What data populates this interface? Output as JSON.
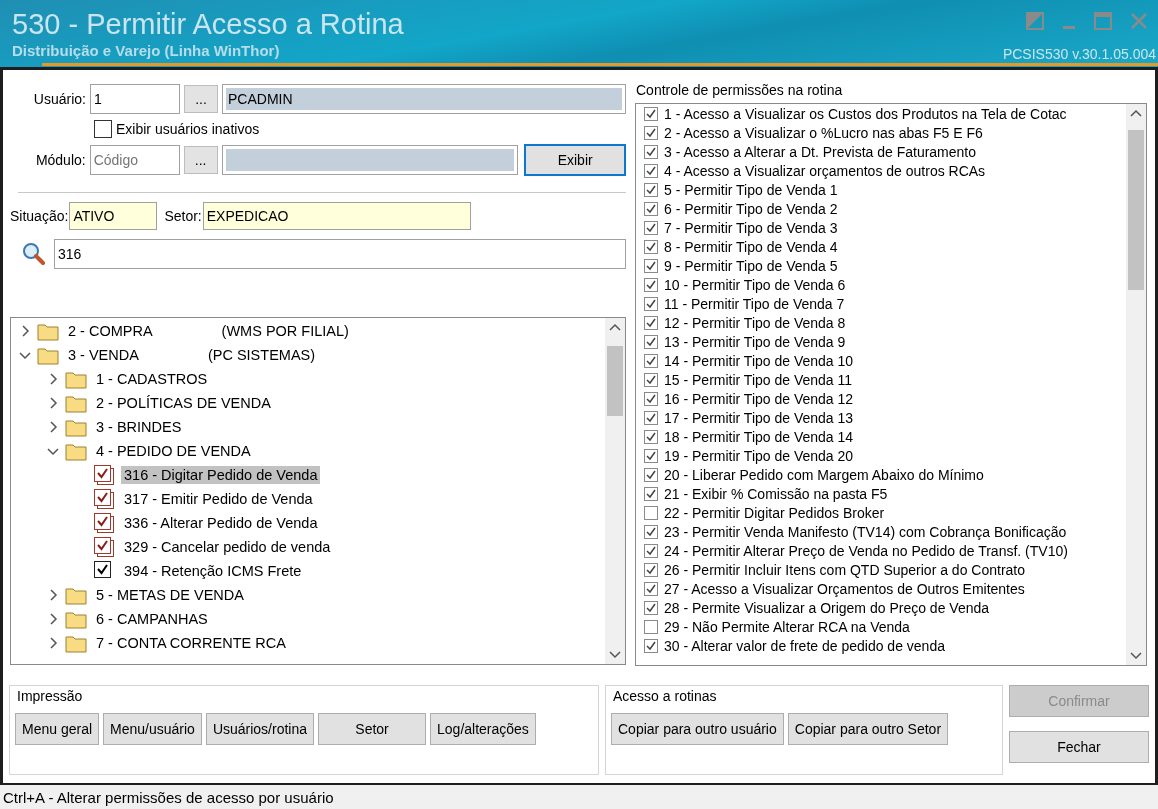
{
  "window": {
    "title": "530 - Permitir Acesso a Rotina",
    "subtitle": "Distribuição e Varejo (Linha WinThor)",
    "version": "PCSIS530  v.30.1.05.004"
  },
  "user": {
    "label": "Usuário:",
    "code": "1",
    "browse": "...",
    "name": "PCADMIN"
  },
  "show_inactive": {
    "label": "Exibir usuários inativos",
    "checked": false
  },
  "module": {
    "label": "Módulo:",
    "placeholder": "Código",
    "browse": "...",
    "button": "Exibir"
  },
  "situation": {
    "label": "Situação:",
    "value": "ATIVO"
  },
  "sector": {
    "label": "Setor:",
    "value": "EXPEDICAO"
  },
  "search": {
    "value": "316"
  },
  "tree": [
    {
      "kind": "folder",
      "label": "2 - COMPRA",
      "note": "(WMS POR FILIAL)",
      "expanded": false,
      "selected": false
    },
    {
      "kind": "folder",
      "label": "3 - VENDA",
      "note": "(PC SISTEMAS)",
      "expanded": true,
      "selected": false,
      "children": [
        {
          "kind": "folder",
          "label": "1 - CADASTROS",
          "expanded": false,
          "selected": false
        },
        {
          "kind": "folder",
          "label": "2 - POLÍTICAS DE VENDA",
          "expanded": false,
          "selected": false
        },
        {
          "kind": "folder",
          "label": "3 - BRINDES",
          "expanded": false,
          "selected": false
        },
        {
          "kind": "folder",
          "label": "4 - PEDIDO DE VENDA",
          "expanded": true,
          "selected": false,
          "children": [
            {
              "kind": "routine",
              "label": "316 - Digitar Pedido de Venda",
              "checked": true,
              "partial": true,
              "selected": true
            },
            {
              "kind": "routine",
              "label": "317 - Emitir Pedido de Venda",
              "checked": true,
              "partial": true,
              "selected": false
            },
            {
              "kind": "routine",
              "label": "336 - Alterar Pedido de Venda",
              "checked": true,
              "partial": true,
              "selected": false
            },
            {
              "kind": "routine",
              "label": "329 - Cancelar pedido de venda",
              "checked": true,
              "partial": true,
              "selected": false
            },
            {
              "kind": "routine",
              "label": "394 - Retenção ICMS Frete",
              "checked": true,
              "partial": false,
              "selected": false
            }
          ]
        },
        {
          "kind": "folder",
          "label": "5 - METAS DE VENDA",
          "expanded": false,
          "selected": false
        },
        {
          "kind": "folder",
          "label": "6 - CAMPANHAS",
          "expanded": false,
          "selected": false
        },
        {
          "kind": "folder",
          "label": "7 - CONTA CORRENTE RCA",
          "expanded": false,
          "selected": false
        }
      ]
    }
  ],
  "permissions": {
    "title": "Controle de permissões na rotina",
    "items": [
      {
        "label": "1 - Acesso a Visualizar os Custos dos Produtos na Tela de Cotac",
        "checked": true
      },
      {
        "label": "2 - Acesso a Visualizar o %Lucro nas abas F5 E F6",
        "checked": true
      },
      {
        "label": "3 - Acesso a Alterar a Dt. Prevista de Faturamento",
        "checked": true
      },
      {
        "label": "4 - Acesso a Visualizar orçamentos de outros RCAs",
        "checked": true
      },
      {
        "label": "5 - Permitir Tipo de Venda 1",
        "checked": true
      },
      {
        "label": "6 - Permitir Tipo de Venda 2",
        "checked": true
      },
      {
        "label": "7 - Permitir Tipo de Venda 3",
        "checked": true
      },
      {
        "label": "8 - Permitir Tipo de Venda 4",
        "checked": true
      },
      {
        "label": "9 - Permitir Tipo de Venda 5",
        "checked": true
      },
      {
        "label": "10 - Permitir Tipo de Venda 6",
        "checked": true
      },
      {
        "label": "11 - Permitir Tipo de Venda 7",
        "checked": true
      },
      {
        "label": "12 - Permitir Tipo de Venda 8",
        "checked": true
      },
      {
        "label": "13 - Permitir Tipo de Venda 9",
        "checked": true
      },
      {
        "label": "14 - Permitir Tipo de Venda 10",
        "checked": true
      },
      {
        "label": "15 - Permitir Tipo de Venda 11",
        "checked": true
      },
      {
        "label": "16 - Permitir Tipo de Venda 12",
        "checked": true
      },
      {
        "label": "17 - Permitir Tipo de Venda 13",
        "checked": true
      },
      {
        "label": "18 - Permitir Tipo de Venda 14",
        "checked": true
      },
      {
        "label": "19 - Permitir Tipo de Venda 20",
        "checked": true
      },
      {
        "label": "20 - Liberar Pedido com Margem Abaixo do Mínimo",
        "checked": true
      },
      {
        "label": "21 - Exibir % Comissão na pasta F5",
        "checked": true
      },
      {
        "label": "22 - Permitir Digitar Pedidos Broker",
        "checked": false
      },
      {
        "label": "23 - Permitir Venda Manifesto (TV14) com Cobrança Bonificação",
        "checked": true
      },
      {
        "label": "24 - Permitir Alterar Preço de Venda no Pedido de Transf. (TV10)",
        "checked": true
      },
      {
        "label": "26 - Permitir Incluir Itens com QTD Superior a do Contrato",
        "checked": true
      },
      {
        "label": "27 - Acesso a Visualizar Orçamentos de Outros Emitentes",
        "checked": true
      },
      {
        "label": "28 - Permite Visualizar a Origem do Preço de Venda",
        "checked": true
      },
      {
        "label": "29 - Não Permite Alterar RCA na Venda",
        "checked": false
      },
      {
        "label": "30 - Alterar valor de frete de pedido de venda",
        "checked": true
      }
    ]
  },
  "print_group": {
    "title": "Impressão",
    "buttons": [
      "Menu geral",
      "Menu/usuário",
      "Usuários/rotina",
      "Setor",
      "Log/alterações"
    ]
  },
  "access_group": {
    "title": "Acesso a rotinas",
    "buttons": [
      "Copiar para outro usuário",
      "Copiar para outro Setor"
    ]
  },
  "actions": [
    {
      "label": "Confirmar",
      "disabled": true
    },
    {
      "label": "Fechar",
      "disabled": false
    }
  ],
  "status_bar": "Ctrl+A - Alterar permissões de acesso por usuário"
}
